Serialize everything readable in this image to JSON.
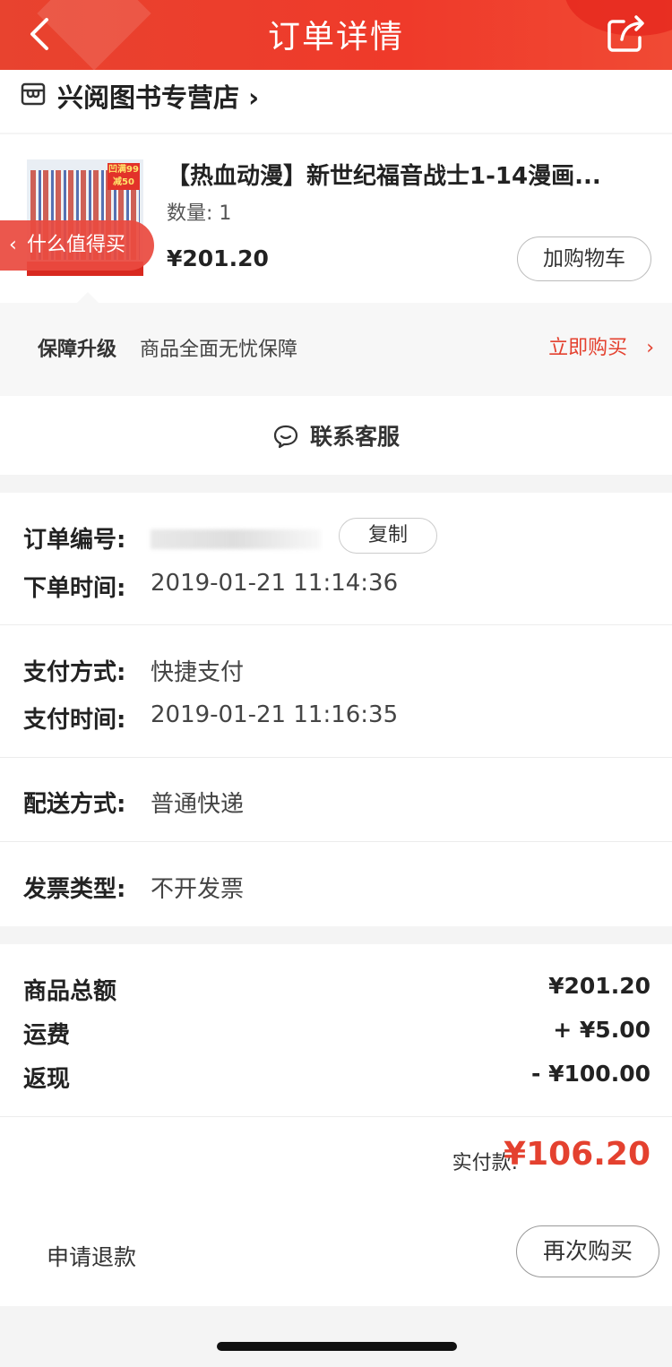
{
  "header": {
    "title": "订单详情"
  },
  "store": {
    "name": "兴阅图书专营店",
    "chevron": "›"
  },
  "product": {
    "title": "【热血动漫】新世纪福音战士1-14漫画...",
    "qty_label": "数量: 1",
    "price": "¥201.20",
    "add_cart_label": "加购物车",
    "image_tag": "凹满99 减50"
  },
  "float_pill": {
    "label": "什么值得买",
    "chevron": "‹"
  },
  "guarantee": {
    "label": "保障升级",
    "desc": "商品全面无忧保障",
    "buy_label": "立即购买",
    "chevron": "›"
  },
  "contact": {
    "label": "联系客服"
  },
  "order_info": {
    "order_no_label": "订单编号:",
    "copy_label": "复制",
    "order_time_label": "下单时间:",
    "order_time": "2019-01-21 11:14:36",
    "pay_method_label": "支付方式:",
    "pay_method": "快捷支付",
    "pay_time_label": "支付时间:",
    "pay_time": "2019-01-21 11:16:35",
    "delivery_label": "配送方式:",
    "delivery": "普通快递",
    "invoice_label": "发票类型:",
    "invoice": "不开发票"
  },
  "amounts": {
    "goods_total_label": "商品总额",
    "goods_total": "¥201.20",
    "shipping_label": "运费",
    "shipping": "+ ¥5.00",
    "cashback_label": "返现",
    "cashback": "- ¥100.00",
    "paid_label": "实付款:",
    "paid": "¥106.20"
  },
  "bottom": {
    "refund_label": "申请退款",
    "rebuy_label": "再次购买"
  },
  "colors": {
    "brand_red": "#e4412f",
    "header_red": "#ef3a2a"
  }
}
